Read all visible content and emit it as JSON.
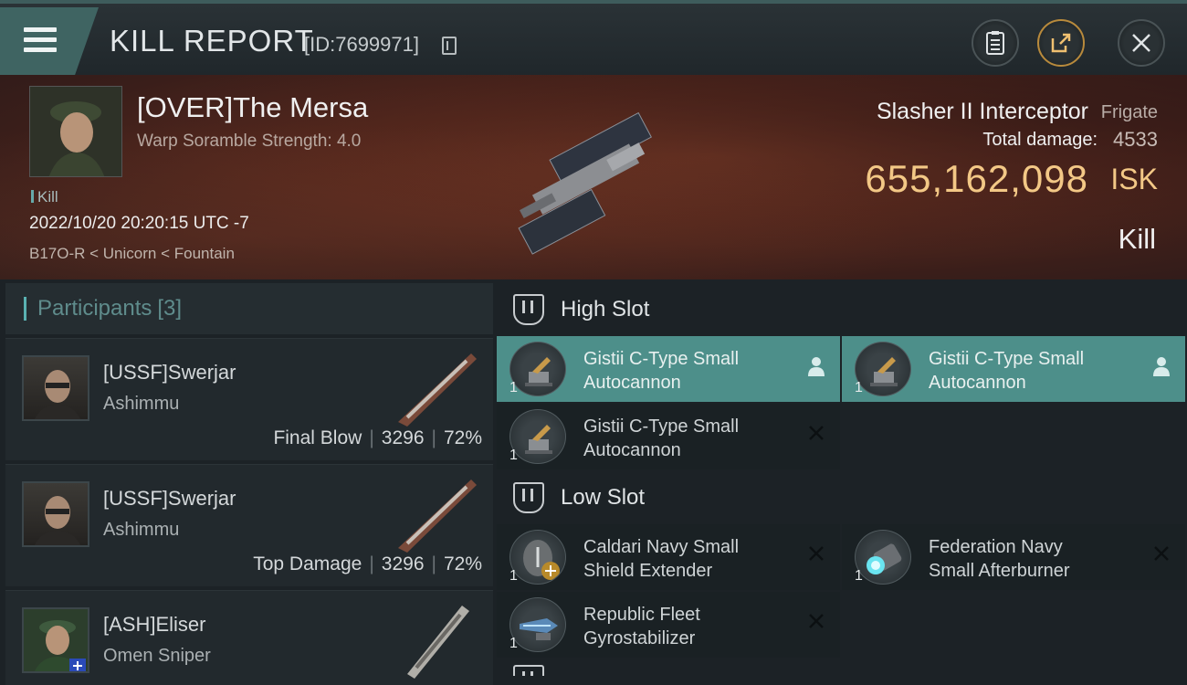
{
  "header": {
    "title": "KILL REPORT",
    "report_id": "[ID:7699971]",
    "menu_icon": "hamburger-icon",
    "buttons": [
      "clipboard-icon",
      "share-icon",
      "close-icon"
    ]
  },
  "victim": {
    "name": "[OVER]The Mersa",
    "subtitle": "Warp Soramble Strength: 4.0",
    "tag": "Kill",
    "datetime": "2022/10/20 20:20:15 UTC -7",
    "location": "B17O-R < Unicorn < Fountain"
  },
  "ship": {
    "name": "Slasher II Interceptor",
    "class": "Frigate",
    "damage_label": "Total damage:",
    "damage_value": "4533",
    "isk_value": "655,162,098",
    "isk_unit": "ISK",
    "result": "Kill"
  },
  "participants": {
    "label": "Participants",
    "count": "[3]",
    "list": [
      {
        "name": "[USSF]Swerjar",
        "ship": "Ashimmu",
        "role": "Final Blow",
        "damage": "3296",
        "percent": "72%"
      },
      {
        "name": "[USSF]Swerjar",
        "ship": "Ashimmu",
        "role": "Top Damage",
        "damage": "3296",
        "percent": "72%"
      },
      {
        "name": "[ASH]Eliser",
        "ship": "Omen Sniper",
        "role": "",
        "damage": "",
        "percent": ""
      }
    ]
  },
  "fittings": {
    "high_slot": {
      "title": "High Slot",
      "modules": [
        {
          "qty": "1",
          "line1": "Gistii C-Type Small",
          "line2": "Autocannon",
          "status": "dropped",
          "status_icon": "person-icon"
        },
        {
          "qty": "1",
          "line1": "Gistii C-Type Small",
          "line2": "Autocannon",
          "status": "dropped",
          "status_icon": "person-icon"
        },
        {
          "qty": "1",
          "line1": "Gistii C-Type Small",
          "line2": "Autocannon",
          "status": "destroyed",
          "status_icon": "x-icon"
        }
      ]
    },
    "low_slot": {
      "title": "Low Slot",
      "modules": [
        {
          "qty": "1",
          "line1": "Caldari Navy Small",
          "line2": "Shield Extender",
          "status": "destroyed",
          "status_icon": "x-icon"
        },
        {
          "qty": "1",
          "line1": "Federation Navy",
          "line2": "Small Afterburner",
          "status": "destroyed",
          "status_icon": "x-icon"
        },
        {
          "qty": "1",
          "line1": "Republic Fleet",
          "line2": "Gyrostabilizer",
          "status": "destroyed",
          "status_icon": "x-icon"
        }
      ]
    }
  },
  "colors": {
    "accent_teal": "#4d8f8a",
    "isk_gold": "#f3c886",
    "banner_red": "#7a3a26"
  }
}
